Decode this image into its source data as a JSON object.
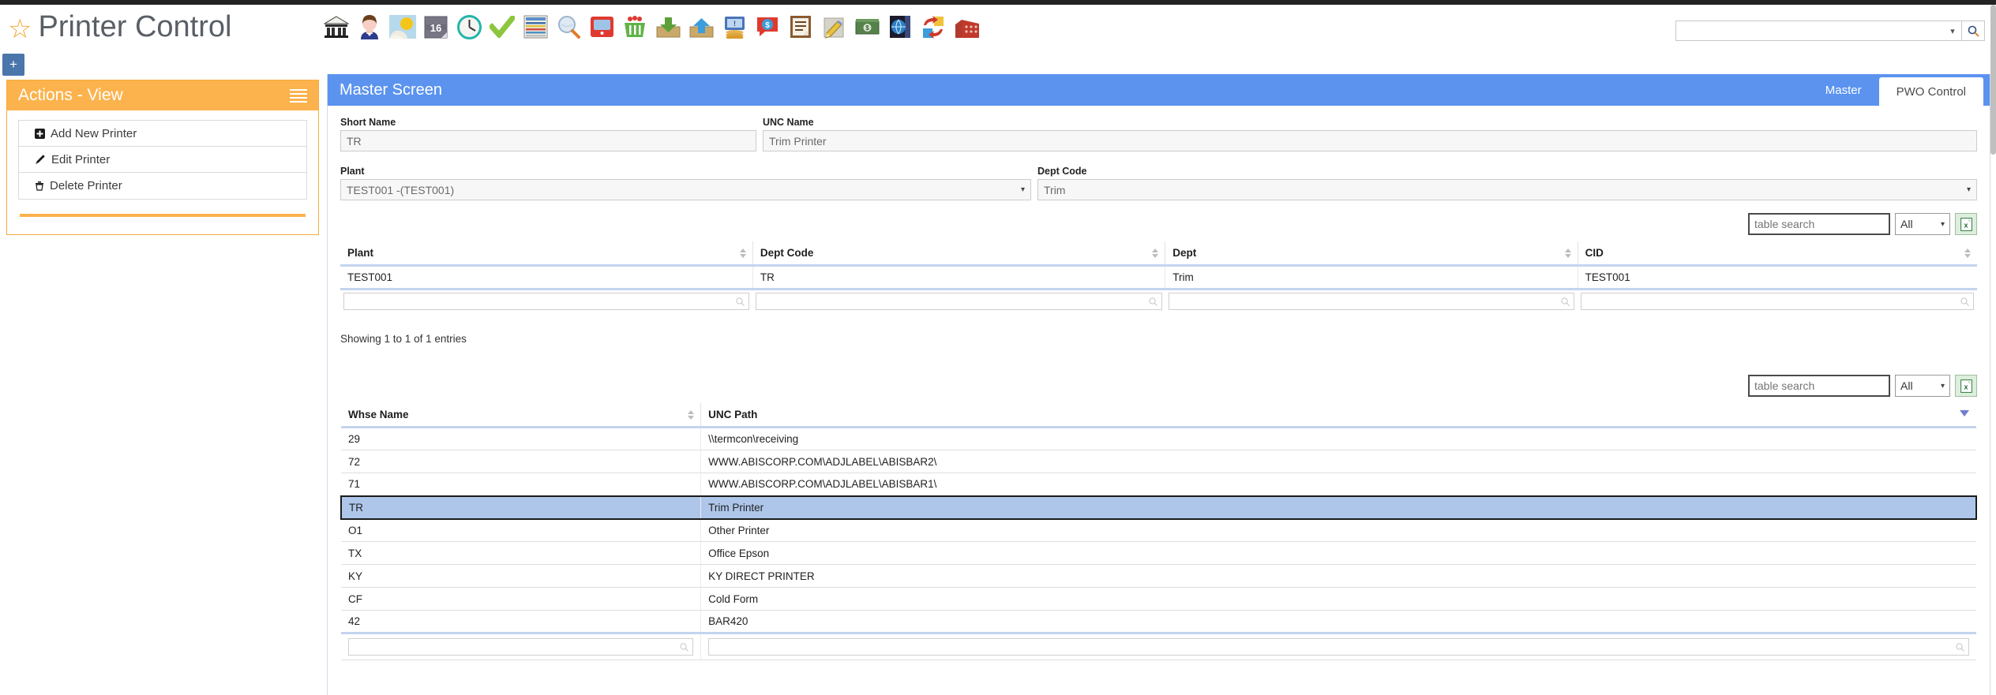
{
  "app": {
    "title": "Printer Control",
    "star_icon": "star-icon"
  },
  "toolbar": {
    "icons": [
      {
        "name": "bank-icon",
        "glyph": "🏦"
      },
      {
        "name": "person-icon",
        "glyph": "👤"
      },
      {
        "name": "weather-icon",
        "glyph": "⛅"
      },
      {
        "name": "calendar-16-icon",
        "glyph": "16"
      },
      {
        "name": "clock-icon",
        "glyph": "🕒"
      },
      {
        "name": "checkmark-icon",
        "glyph": "✔"
      },
      {
        "name": "spreadsheet-icon",
        "glyph": "🗒"
      },
      {
        "name": "search-globe-icon",
        "glyph": "🔍"
      },
      {
        "name": "monitor-icon",
        "glyph": "🖥"
      },
      {
        "name": "shopping-basket-icon",
        "glyph": "🛒"
      },
      {
        "name": "download-inbox-icon",
        "glyph": "⬇"
      },
      {
        "name": "upload-outbox-icon",
        "glyph": "⬆"
      },
      {
        "name": "coins-monitor-icon",
        "glyph": "💰"
      },
      {
        "name": "money-chat-icon",
        "glyph": "💬"
      },
      {
        "name": "clipboard-icon",
        "glyph": "📋"
      },
      {
        "name": "pencil-note-icon",
        "glyph": "✏"
      },
      {
        "name": "cash-icon",
        "glyph": "💵"
      },
      {
        "name": "globe-device-icon",
        "glyph": "🌐"
      },
      {
        "name": "swap-arrows-icon",
        "glyph": "🔁"
      },
      {
        "name": "factory-icon",
        "glyph": "🏭"
      }
    ]
  },
  "global_search": {
    "value": "",
    "placeholder": "",
    "caret_icon": "chevron-down-icon",
    "search_icon": "search-icon"
  },
  "add_button": {
    "label": "+"
  },
  "actions_panel": {
    "title": "Actions - View",
    "menu_icon": "hamburger-icon",
    "items": [
      {
        "label": "Add New Printer",
        "icon": "plus-square-icon",
        "glyph": "✚"
      },
      {
        "label": "Edit Printer",
        "icon": "pencil-icon",
        "glyph": "✎"
      },
      {
        "label": "Delete Printer",
        "icon": "trash-icon",
        "glyph": "🗑"
      }
    ]
  },
  "master_screen": {
    "title": "Master Screen",
    "tabs": [
      {
        "label": "Master",
        "active": false
      },
      {
        "label": "PWO Control",
        "active": true
      }
    ],
    "fields": {
      "short_name": {
        "label": "Short Name",
        "value": "TR"
      },
      "unc_name": {
        "label": "UNC Name",
        "value": "Trim Printer"
      },
      "plant": {
        "label": "Plant",
        "value": "TEST001 -(TEST001)"
      },
      "dept_code": {
        "label": "Dept Code",
        "value": "Trim"
      }
    }
  },
  "table1": {
    "search": {
      "value": "",
      "placeholder": "table search"
    },
    "page_size": {
      "value": "All"
    },
    "export_icon": "excel-export-icon",
    "columns": [
      "Plant",
      "Dept Code",
      "Dept",
      "CID"
    ],
    "rows": [
      [
        "TEST001",
        "TR",
        "Trim",
        "TEST001"
      ]
    ],
    "filter_placeholder": "",
    "info": "Showing 1 to 1 of 1 entries"
  },
  "table2": {
    "search": {
      "value": "",
      "placeholder": "table search"
    },
    "page_size": {
      "value": "All"
    },
    "export_icon": "excel-export-icon",
    "collapse_icon": "collapse-triangle-icon",
    "columns": [
      "Whse Name",
      "UNC Path"
    ],
    "rows": [
      {
        "whse": "29",
        "path": "\\\\termcon\\receiving",
        "selected": false
      },
      {
        "whse": "72",
        "path": "WWW.ABISCORP.COM\\ADJLABEL\\ABISBAR2\\",
        "selected": false
      },
      {
        "whse": "71",
        "path": "WWW.ABISCORP.COM\\ADJLABEL\\ABISBAR1\\",
        "selected": false
      },
      {
        "whse": "TR",
        "path": "Trim Printer",
        "selected": true
      },
      {
        "whse": "O1",
        "path": "Other Printer",
        "selected": false
      },
      {
        "whse": "TX",
        "path": "Office Epson",
        "selected": false
      },
      {
        "whse": "KY",
        "path": "KY DIRECT PRINTER",
        "selected": false
      },
      {
        "whse": "CF",
        "path": "Cold Form",
        "selected": false
      },
      {
        "whse": "42",
        "path": "BAR420",
        "selected": false
      }
    ]
  },
  "colors": {
    "accent_blue": "#5b93ef",
    "accent_orange": "#fcb34d",
    "selected_row": "#aec6ea",
    "plus_button": "#4a76ab"
  }
}
